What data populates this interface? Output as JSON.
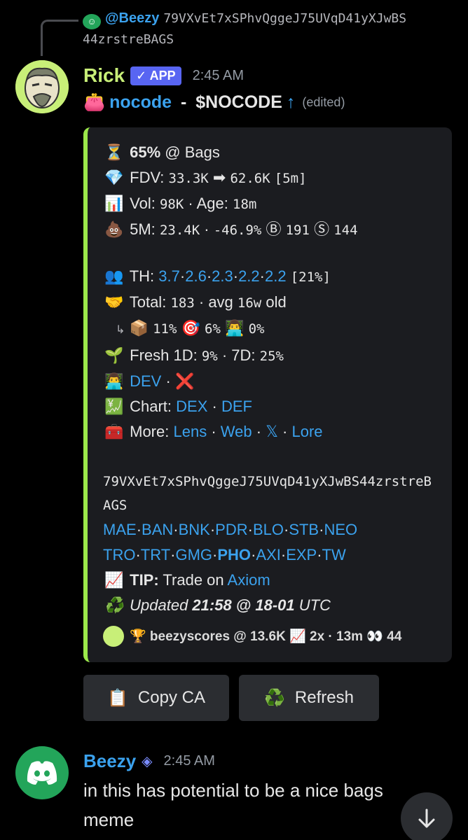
{
  "reply": {
    "user": "@Beezy",
    "text_line1": "79VXvEt7xSPhvQggeJ75UVqD41yXJwBS",
    "text_line2": "44zrstreBAGS"
  },
  "message": {
    "author": "Rick",
    "app_tag": "✓ APP",
    "time": "2:45 AM",
    "title_emoji": "👛",
    "title_name": "nocode",
    "title_sep": " - ",
    "title_ticker": "$NOCODE",
    "title_arrow": "↑",
    "edited": "(edited)"
  },
  "embed": {
    "progress": {
      "emoji": "⏳",
      "value": "65%",
      "suffix": " @ Bags"
    },
    "fdv": {
      "emoji": "💎",
      "label": "FDV:",
      "from": "33.3K",
      "arrow": "➡",
      "to": "62.6K",
      "window": "[5m]"
    },
    "vol": {
      "emoji": "📊",
      "label": "Vol:",
      "value": "98K",
      "sep": " · ",
      "age_label": "Age:",
      "age": "18m"
    },
    "five_m": {
      "emoji": "💩",
      "label": "5M:",
      "value": "23.4K",
      "sep": " · ",
      "change": "-46.9%",
      "b_icon": "Ⓑ",
      "b": "191",
      "s_icon": "Ⓢ",
      "s": "144"
    },
    "th": {
      "emoji": "👥",
      "label": "TH:",
      "values": [
        "3.7",
        "2.6",
        "2.3",
        "2.2",
        "2.2"
      ],
      "pct": "[21%]"
    },
    "total": {
      "emoji": "🤝",
      "label": "Total:",
      "value": "183",
      "avg_label": " · avg ",
      "avg": "16w",
      "suffix": " old"
    },
    "sub": {
      "arrow": "↳",
      "e1": "📦",
      "v1": "11%",
      "e2": "🎯",
      "v2": "6%",
      "e3": "👨‍💻",
      "v3": "0%"
    },
    "fresh": {
      "emoji": "🌱",
      "label1": "Fresh 1D:",
      "v1": "9%",
      "sep": " · ",
      "label2": "7D:",
      "v2": "25%"
    },
    "dev": {
      "emoji": "👨‍💻",
      "link": "DEV",
      "sep": " · ",
      "x_icon": "❌"
    },
    "chart": {
      "emoji": "💹",
      "label": "Chart:",
      "link1": "DEX",
      "sep": " · ",
      "link2": "DEF"
    },
    "more": {
      "emoji": "🧰",
      "label": "More:",
      "link1": "Lens",
      "link2": "Web",
      "link3": "𝕏",
      "link4": "Lore",
      "sep": " · "
    },
    "ca": "79VXvEt7xSPhvQggeJ75UVqD41yXJwBS44zrstreBAGS",
    "dex_row1": [
      "MAE",
      "BAN",
      "BNK",
      "PDR",
      "BLO",
      "STB",
      "NEO"
    ],
    "dex_row2": [
      "TRO",
      "TRT",
      "GMG",
      "PHO",
      "AXI",
      "EXP",
      "TW"
    ],
    "tip": {
      "emoji": "📈",
      "label": "TIP:",
      "text": " Trade on ",
      "link": "Axiom"
    },
    "updated": {
      "emoji": "♻️",
      "text": "Updated ",
      "time": "21:58 @ 18-01",
      "suffix": " UTC"
    },
    "footer": {
      "text": "🏆 beezyscores @ 13.6K 📈 2x · 13m 👀 44"
    }
  },
  "buttons": {
    "copy": {
      "icon": "📋",
      "label": "Copy CA"
    },
    "refresh": {
      "icon": "♻️",
      "label": "Refresh"
    }
  },
  "message2": {
    "author": "Beezy",
    "time": "2:45 AM",
    "text": "in this has potential to be a nice bags meme"
  },
  "colors": {
    "accent_bar": "#9be84a",
    "link": "#3ba2ee",
    "app_tag": "#5865f2",
    "author": "#c8ef78"
  }
}
